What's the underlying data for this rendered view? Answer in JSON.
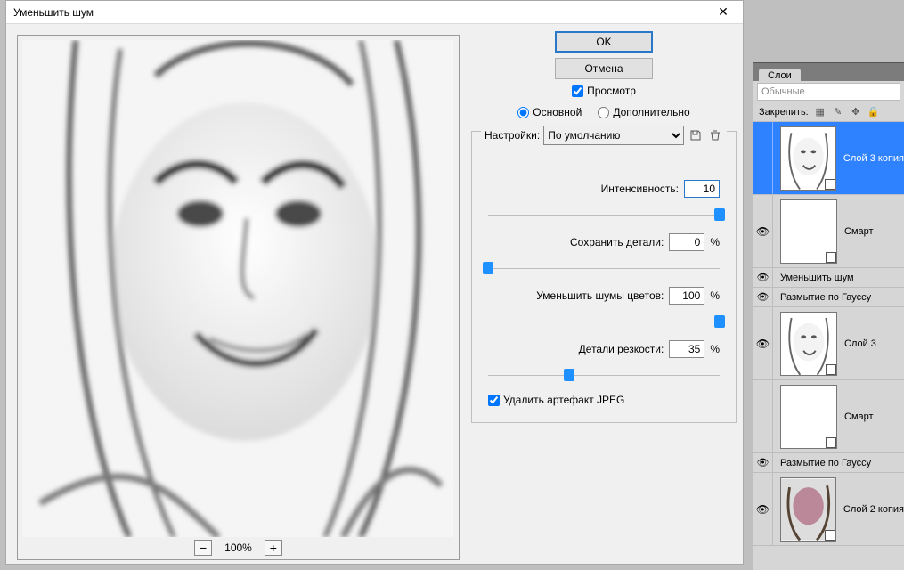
{
  "dialog": {
    "title": "Уменьшить шум",
    "ok_label": "OK",
    "cancel_label": "Отмена",
    "preview_checkbox": "Просмотр",
    "mode_basic": "Основной",
    "mode_advanced": "Дополнительно",
    "settings_label": "Настройки:",
    "settings_value": "По умолчанию",
    "zoom_level": "100%",
    "sliders": {
      "strength": {
        "label": "Интенсивность:",
        "value": "10",
        "pct": 100,
        "active": true
      },
      "preserve": {
        "label": "Сохранить детали:",
        "value": "0",
        "pct": 0,
        "unit": "%",
        "active": false
      },
      "color": {
        "label": "Уменьшить шумы цветов:",
        "value": "100",
        "pct": 100,
        "unit": "%",
        "active": false
      },
      "sharpen": {
        "label": "Детали резкости:",
        "value": "35",
        "pct": 35,
        "unit": "%",
        "active": false
      }
    },
    "remove_jpeg": "Удалить артефакт JPEG"
  },
  "layers_panel": {
    "tab": "Слои",
    "blend_mode": "Обычные",
    "lock_label": "Закрепить:",
    "items": [
      {
        "name": "Слой 3 копия",
        "thumb": "sketch",
        "selected": true,
        "eye": false
      },
      {
        "name": "Смарт",
        "thumb": "white",
        "selected": false,
        "eye": true,
        "filters": [
          "Уменьшить шум",
          "Размытие по Гауссу"
        ]
      },
      {
        "name": "Слой 3",
        "thumb": "sketch",
        "selected": false,
        "eye": true
      },
      {
        "name": "Смарт",
        "thumb": "white",
        "selected": false,
        "eye": false,
        "filters": [
          "Размытие по Гауссу"
        ]
      },
      {
        "name": "Слой 2 копия",
        "thumb": "photo",
        "selected": false,
        "eye": true
      }
    ]
  }
}
